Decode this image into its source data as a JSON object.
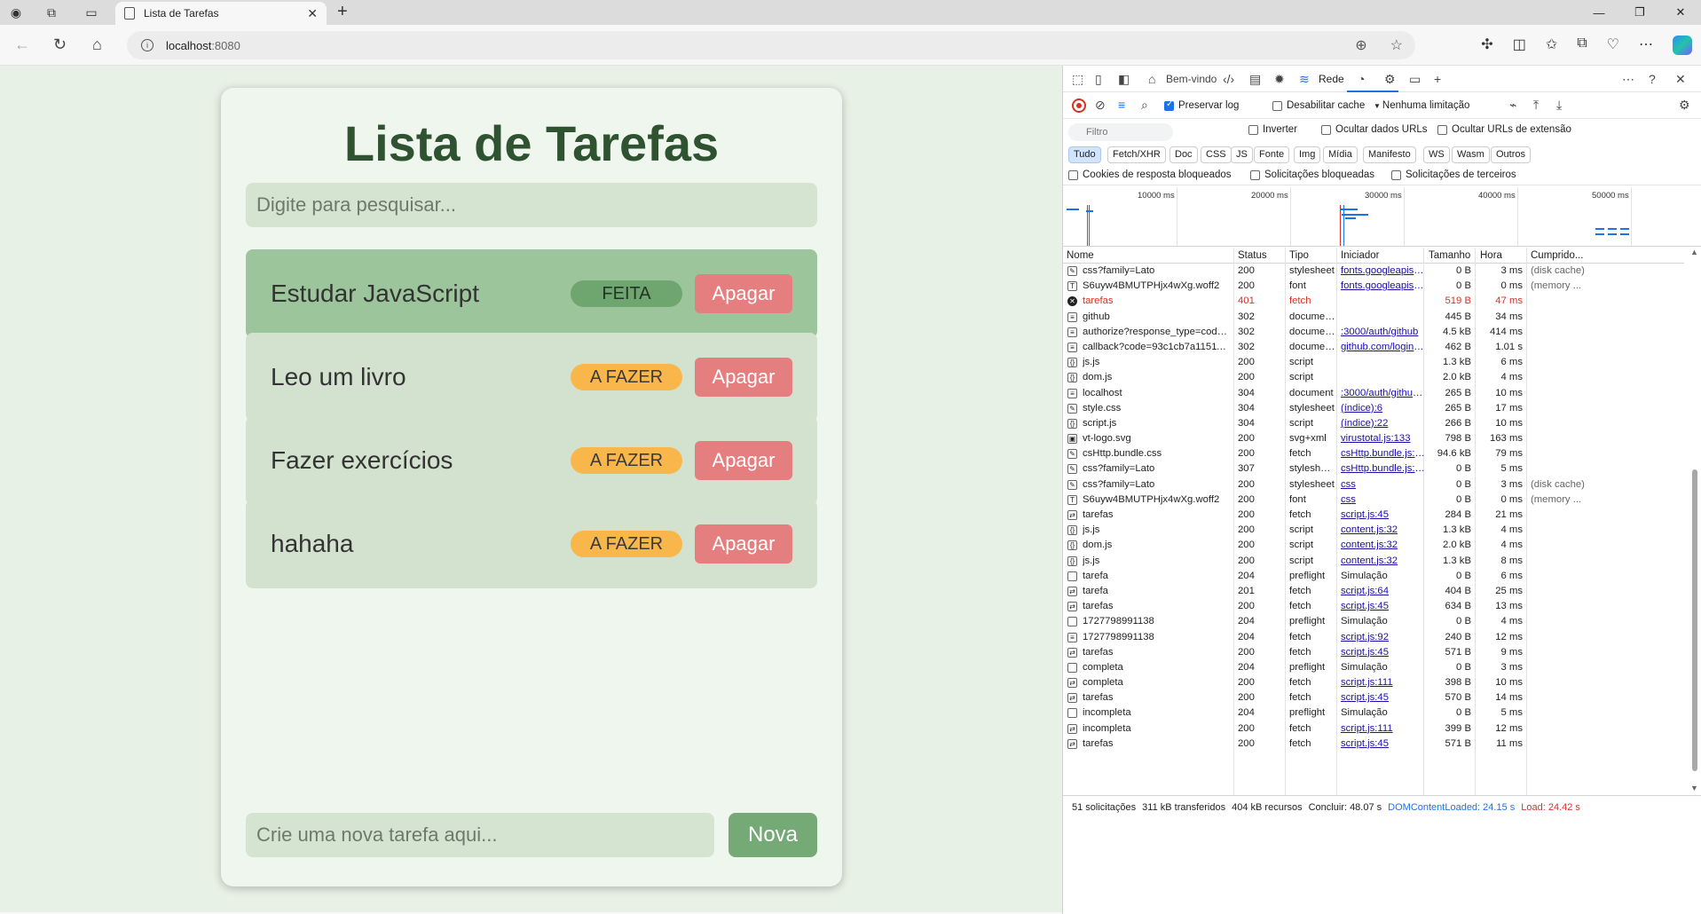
{
  "browser": {
    "tab_title": "Lista de Tarefas",
    "url_host": "localhost",
    "url_port": ":8080"
  },
  "app": {
    "title": "Lista de Tarefas",
    "search_placeholder": "Digite para pesquisar...",
    "tasks": [
      {
        "name": "Estudar JavaScript",
        "status": "FEITA",
        "delete_label": "Apagar",
        "done": true
      },
      {
        "name": "Leo um livro",
        "status": "A FAZER",
        "delete_label": "Apagar",
        "done": false
      },
      {
        "name": "Fazer exercícios",
        "status": "A FAZER",
        "delete_label": "Apagar",
        "done": false
      },
      {
        "name": "hahaha",
        "status": "A FAZER",
        "delete_label": "Apagar",
        "done": false
      }
    ],
    "new_placeholder": "Crie uma nova tarefa aqui...",
    "new_button": "Nova"
  },
  "devtools": {
    "tabs": {
      "welcome": "Bem-vindo",
      "network": "Rede"
    },
    "toolbar": {
      "preserve_log": "Preservar log",
      "disable_cache": "Desabilitar cache",
      "throttling": "Nenhuma limitação"
    },
    "filter": {
      "placeholder": "Filtro",
      "invert": "Inverter",
      "hide_data_urls": "Ocultar dados URLs",
      "hide_extension_urls": "Ocultar URLs de extensão"
    },
    "chips": [
      "Tudo",
      "Fetch/XHR",
      "Doc",
      "CSS",
      "JS",
      "Fonte",
      "Img",
      "Mídia",
      "Manifesto",
      "WS",
      "Wasm",
      "Outros"
    ],
    "blocked": {
      "cookies": "Cookies de resposta bloqueados",
      "requests": "Solicitações bloqueadas",
      "third_party": "Solicitações de terceiros"
    },
    "overview_ticks": [
      "10000 ms",
      "20000 ms",
      "30000 ms",
      "40000 ms",
      "50000 ms"
    ],
    "columns": {
      "name": "Nome",
      "status": "Status",
      "type": "Tipo",
      "initiator": "Iniciador",
      "size": "Tamanho",
      "time": "Hora",
      "fulfilled": "Cumprido..."
    },
    "requests": [
      {
        "name": "css?family=Lato",
        "status": "200",
        "type": "stylesheet",
        "initiator": "fonts.googleapis.com",
        "size": "0 B",
        "time": "3 ms",
        "cache": "(disk cache)",
        "icon": "css"
      },
      {
        "name": "S6uyw4BMUTPHjx4wXg.woff2",
        "status": "200",
        "type": "font",
        "initiator": "fonts.googleapis.com",
        "size": "0 B",
        "time": "0 ms",
        "cache": "(memory ...",
        "icon": "font"
      },
      {
        "name": "tarefas",
        "status": "401",
        "type": "fetch",
        "initiator": "",
        "size": "519 B",
        "time": "47 ms",
        "cache": "",
        "icon": "error",
        "error": true
      },
      {
        "name": "github",
        "status": "302",
        "type": "documen...",
        "initiator": "",
        "size": "445 B",
        "time": "34 ms",
        "cache": "",
        "icon": "doc"
      },
      {
        "name": "authorize?response_type=code&redi...",
        "status": "302",
        "type": "documen...",
        "initiator": ":3000/auth/github",
        "size": "4.5 kB",
        "time": "414 ms",
        "cache": "",
        "icon": "doc"
      },
      {
        "name": "callback?code=93c1cb7a11511d3637...",
        "status": "302",
        "type": "documen...",
        "initiator": "github.com/login/oa",
        "size": "462 B",
        "time": "1.01 s",
        "cache": "",
        "icon": "doc"
      },
      {
        "name": "js.js",
        "status": "200",
        "type": "script",
        "initiator": "",
        "size": "1.3 kB",
        "time": "6 ms",
        "cache": "",
        "icon": "js"
      },
      {
        "name": "dom.js",
        "status": "200",
        "type": "script",
        "initiator": "",
        "size": "2.0 kB",
        "time": "4 ms",
        "cache": "",
        "icon": "js"
      },
      {
        "name": "localhost",
        "status": "304",
        "type": "document",
        "initiator": ":3000/auth/github/ca",
        "size": "265 B",
        "time": "10 ms",
        "cache": "",
        "icon": "doc"
      },
      {
        "name": "style.css",
        "status": "304",
        "type": "stylesheet",
        "initiator": "(índice):6",
        "size": "265 B",
        "time": "17 ms",
        "cache": "",
        "icon": "css"
      },
      {
        "name": "script.js",
        "status": "304",
        "type": "script",
        "initiator": "(índice):22",
        "size": "266 B",
        "time": "10 ms",
        "cache": "",
        "icon": "js"
      },
      {
        "name": "vt-logo.svg",
        "status": "200",
        "type": "svg+xml",
        "initiator": "virustotal.js:133",
        "size": "798 B",
        "time": "163 ms",
        "cache": "",
        "icon": "img"
      },
      {
        "name": "csHttp.bundle.css",
        "status": "200",
        "type": "fetch",
        "initiator": "csHttp.bundle.js:72",
        "size": "94.6 kB",
        "time": "79 ms",
        "cache": "",
        "icon": "css"
      },
      {
        "name": "css?family=Lato",
        "status": "307",
        "type": "styleshee...",
        "initiator": "csHttp.bundle.js:72",
        "size": "0 B",
        "time": "5 ms",
        "cache": "",
        "icon": "css"
      },
      {
        "name": "css?family=Lato",
        "status": "200",
        "type": "stylesheet",
        "initiator": "css",
        "size": "0 B",
        "time": "3 ms",
        "cache": "(disk cache)",
        "icon": "css"
      },
      {
        "name": "S6uyw4BMUTPHjx4wXg.woff2",
        "status": "200",
        "type": "font",
        "initiator": "css",
        "size": "0 B",
        "time": "0 ms",
        "cache": "(memory ...",
        "icon": "font"
      },
      {
        "name": "tarefas",
        "status": "200",
        "type": "fetch",
        "initiator": "script.js:45",
        "size": "284 B",
        "time": "21 ms",
        "cache": "",
        "icon": "fetch"
      },
      {
        "name": "js.js",
        "status": "200",
        "type": "script",
        "initiator": "content.js:32",
        "size": "1.3 kB",
        "time": "4 ms",
        "cache": "",
        "icon": "js"
      },
      {
        "name": "dom.js",
        "status": "200",
        "type": "script",
        "initiator": "content.js:32",
        "size": "2.0 kB",
        "time": "4 ms",
        "cache": "",
        "icon": "js"
      },
      {
        "name": "js.js",
        "status": "200",
        "type": "script",
        "initiator": "content.js:32",
        "size": "1.3 kB",
        "time": "8 ms",
        "cache": "",
        "icon": "js"
      },
      {
        "name": "tarefa",
        "status": "204",
        "type": "preflight",
        "initiator": "Simulação",
        "size": "0 B",
        "time": "6 ms",
        "cache": "",
        "icon": "pre",
        "plain_init": true
      },
      {
        "name": "tarefa",
        "status": "201",
        "type": "fetch",
        "initiator": "script.js:64",
        "size": "404 B",
        "time": "25 ms",
        "cache": "",
        "icon": "fetch"
      },
      {
        "name": "tarefas",
        "status": "200",
        "type": "fetch",
        "initiator": "script.js:45",
        "size": "634 B",
        "time": "13 ms",
        "cache": "",
        "icon": "fetch"
      },
      {
        "name": "1727798991138",
        "status": "204",
        "type": "preflight",
        "initiator": "Simulação",
        "size": "0 B",
        "time": "4 ms",
        "cache": "",
        "icon": "pre",
        "plain_init": true
      },
      {
        "name": "1727798991138",
        "status": "204",
        "type": "fetch",
        "initiator": "script.js:92",
        "size": "240 B",
        "time": "12 ms",
        "cache": "",
        "icon": "doc"
      },
      {
        "name": "tarefas",
        "status": "200",
        "type": "fetch",
        "initiator": "script.js:45",
        "size": "571 B",
        "time": "9 ms",
        "cache": "",
        "icon": "fetch"
      },
      {
        "name": "completa",
        "status": "204",
        "type": "preflight",
        "initiator": "Simulação",
        "size": "0 B",
        "time": "3 ms",
        "cache": "",
        "icon": "pre",
        "plain_init": true
      },
      {
        "name": "completa",
        "status": "200",
        "type": "fetch",
        "initiator": "script.js:111",
        "size": "398 B",
        "time": "10 ms",
        "cache": "",
        "icon": "fetch"
      },
      {
        "name": "tarefas",
        "status": "200",
        "type": "fetch",
        "initiator": "script.js:45",
        "size": "570 B",
        "time": "14 ms",
        "cache": "",
        "icon": "fetch"
      },
      {
        "name": "incompleta",
        "status": "204",
        "type": "preflight",
        "initiator": "Simulação",
        "size": "0 B",
        "time": "5 ms",
        "cache": "",
        "icon": "pre",
        "plain_init": true
      },
      {
        "name": "incompleta",
        "status": "200",
        "type": "fetch",
        "initiator": "script.js:111",
        "size": "399 B",
        "time": "12 ms",
        "cache": "",
        "icon": "fetch"
      },
      {
        "name": "tarefas",
        "status": "200",
        "type": "fetch",
        "initiator": "script.js:45",
        "size": "571 B",
        "time": "11 ms",
        "cache": "",
        "icon": "fetch"
      }
    ],
    "status_bar": {
      "requests": "51 solicitações",
      "transferred": "311 kB transferidos",
      "resources": "404 kB recursos",
      "finish": "Concluir: 48.07 s",
      "dom_loaded": "DOMContentLoaded: 24.15 s",
      "load": "Load: 24.42 s"
    }
  }
}
